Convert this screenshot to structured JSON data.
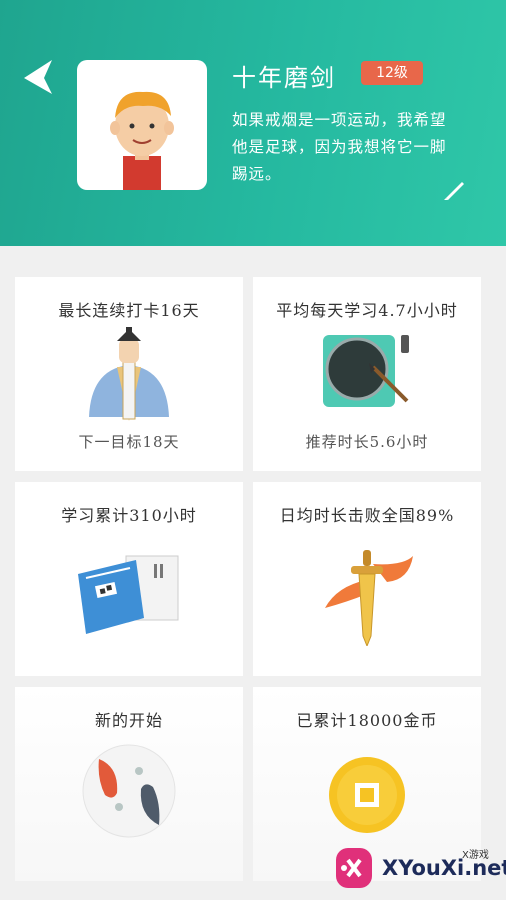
{
  "header": {
    "user_name": "十年磨剑",
    "level_badge": "12级",
    "signature": "如果戒烟是一项运动，我希望他是足球，因为我想将它一脚踢远。"
  },
  "cards": [
    {
      "title": "最长连续打卡16天",
      "subtitle": "下一目标18天",
      "icon": "scholar-icon"
    },
    {
      "title": "平均每天学习4.7小小时",
      "subtitle": "推荐时长5.6小时",
      "icon": "inkstone-icon"
    },
    {
      "title": "学习累计310小时",
      "subtitle": "",
      "icon": "book-scroll-icon"
    },
    {
      "title": "日均时长击败全国89%",
      "subtitle": "",
      "icon": "sword-icon"
    },
    {
      "title": "新的开始",
      "subtitle": "",
      "icon": "koi-fish-icon"
    },
    {
      "title": "已累计18000金币",
      "subtitle": "",
      "icon": "gold-coin-icon"
    }
  ],
  "watermark": {
    "text": "XYouXi.net",
    "small": "X游戏"
  },
  "colors": {
    "header": "#25b9a0",
    "badge": "#e8674a"
  }
}
